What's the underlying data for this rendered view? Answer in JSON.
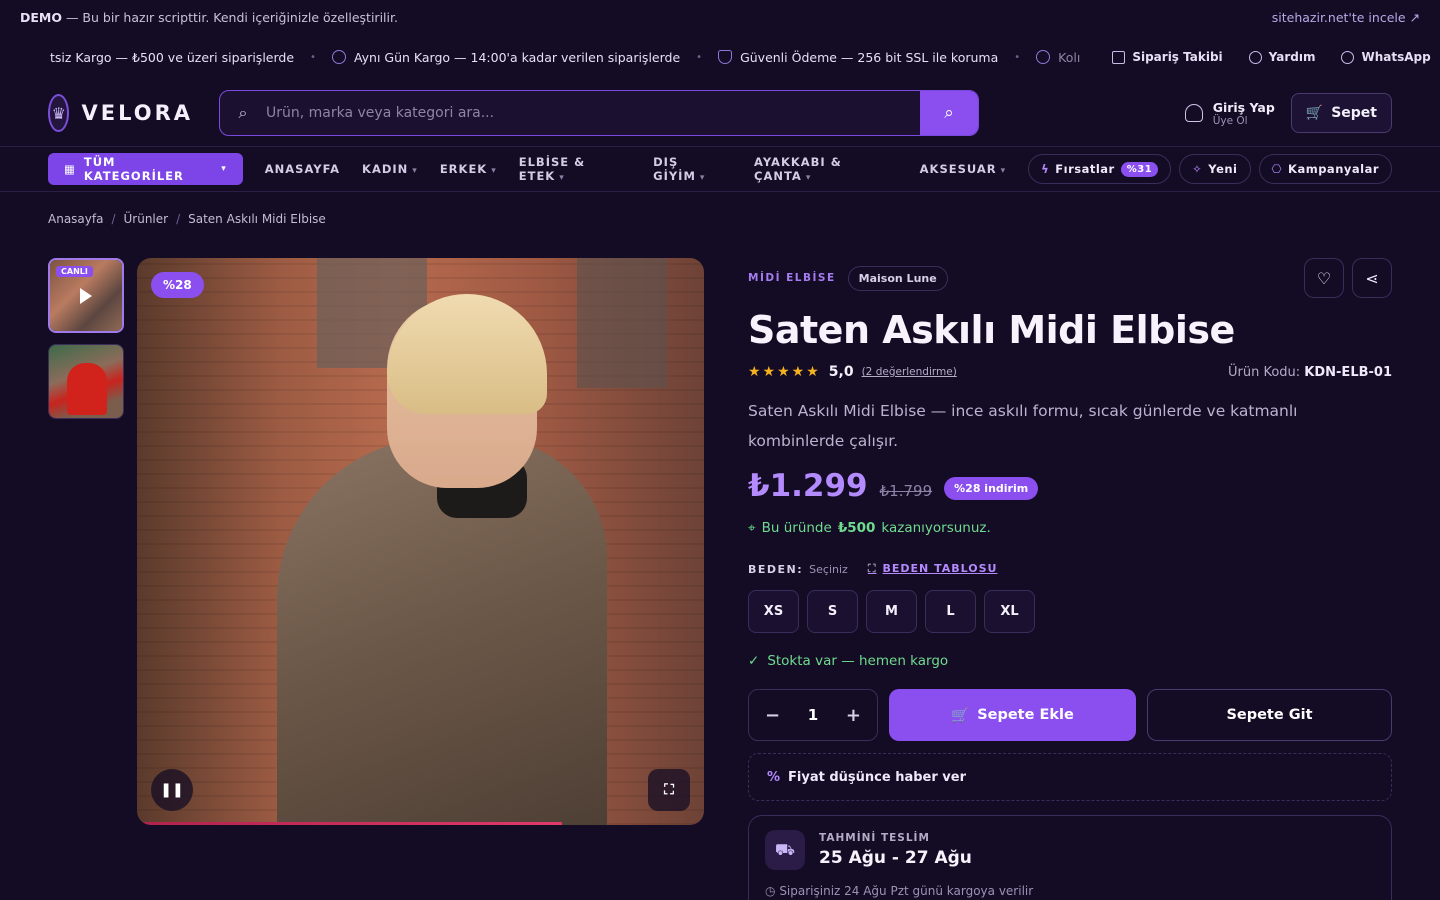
{
  "demo_bar": {
    "label": "DEMO",
    "text": " — Bu bir hazır scripttir. Kendi içeriğinizle özelleştirilir.",
    "link": "sitehazir.net'te incele ↗"
  },
  "ticker": {
    "items": [
      "tsiz Kargo — ₺500 ve üzeri siparişlerde",
      "Aynı Gün Kargo — 14:00'a kadar verilen siparişlerde",
      "Güvenli Ödeme — 256 bit SSL ile koruma",
      "Kolı"
    ],
    "quick_links": [
      "Sipariş Takibi",
      "Yardım",
      "WhatsApp"
    ]
  },
  "header": {
    "logo": "VELORA",
    "search_placeholder": "Ürün, marka veya kategori ara...",
    "login_title": "Giriş Yap",
    "login_sub": "Üye Ol",
    "cart_label": "Sepet"
  },
  "nav": {
    "all_categories": "TÜM KATEGORİLER",
    "items": [
      "ANASAYFA",
      "KADIN",
      "ERKEK",
      "ELBİSE & ETEK",
      "DIŞ GİYİM",
      "AYAKKABI & ÇANTA",
      "AKSESUAR"
    ],
    "deals": "Fırsatlar",
    "deals_badge": "%31",
    "new": "Yeni",
    "campaigns": "Kampanyalar"
  },
  "breadcrumb": [
    "Anasayfa",
    "Ürünler",
    "Saten Askılı Midi Elbise"
  ],
  "gallery": {
    "live_label": "CANLI",
    "discount_badge": "%28"
  },
  "product": {
    "category": "MİDİ ELBİSE",
    "brand": "Maison Lune",
    "title": "Saten Askılı Midi Elbise",
    "rating": "5,0",
    "review_count": "(2 değerlendirme)",
    "code_label": "Ürün Kodu:",
    "code": "KDN-ELB-01",
    "description": "Saten Askılı Midi Elbise — ince askılı formu, sıcak günlerde ve katmanlı kombinlerde çalışır.",
    "price": "₺1.299",
    "old_price": "₺1.799",
    "discount": "%28 indirim",
    "earn_prefix": "Bu üründe",
    "earn_amount": "₺500",
    "earn_suffix": "kazanıyorsunuz.",
    "size_label": "BEDEN:",
    "size_select": "Seçiniz",
    "size_table": "BEDEN TABLOSU",
    "sizes": [
      "XS",
      "S",
      "M",
      "L",
      "XL"
    ],
    "stock": "Stokta var — hemen kargo",
    "quantity": "1",
    "add_to_cart": "Sepete Ekle",
    "go_to_cart": "Sepete Git",
    "price_alert": "Fiyat düşünce haber ver",
    "delivery_label": "TAHMİNİ TESLİM",
    "delivery_dates": "25 Ağu - 27 Ağu",
    "delivery_note": "Siparişiniz 24 Ağu Pzt günü kargoya verilir"
  },
  "colors": {
    "accent": "#8b4ff0",
    "background": "#140b24",
    "success": "#6fdb8e",
    "star": "#f5b21f"
  }
}
